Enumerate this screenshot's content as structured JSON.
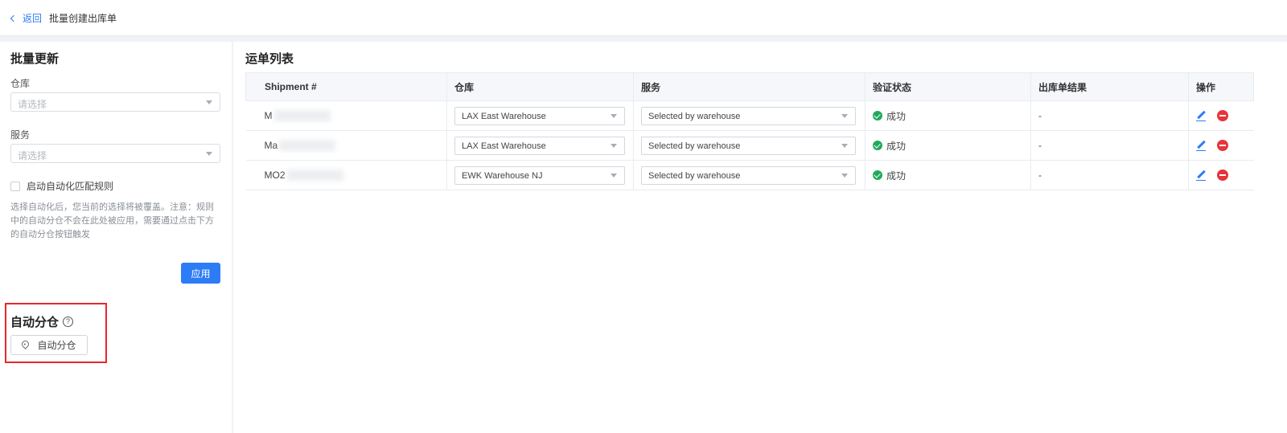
{
  "header": {
    "back_label": "返回",
    "title": "批量创建出库单"
  },
  "bulk_update": {
    "title": "批量更新",
    "warehouse_label": "仓库",
    "warehouse_placeholder": "请选择",
    "service_label": "服务",
    "service_placeholder": "请选择",
    "auto_match_label": "启动自动化匹配规则",
    "hint": "选择自动化后，您当前的选择将被覆盖。注意：规则中的自动分仓不会在此处被应用，需要通过点击下方的自动分仓按钮触发",
    "apply_label": "应用"
  },
  "auto_allocate": {
    "title": "自动分仓",
    "help_icon": "question-circle-icon",
    "button_label": "自动分仓",
    "button_icon": "location-pin-icon"
  },
  "shipments": {
    "title": "运单列表",
    "columns": [
      "Shipment #",
      "仓库",
      "服务",
      "验证状态",
      "出库单结果",
      "操作"
    ],
    "rows": [
      {
        "shipment": "M",
        "warehouse": "LAX East Warehouse",
        "service": "Selected by warehouse",
        "status": "成功",
        "result": "-"
      },
      {
        "shipment": "Ma",
        "warehouse": "LAX East Warehouse",
        "service": "Selected by warehouse",
        "status": "成功",
        "result": "-"
      },
      {
        "shipment": "MO2",
        "warehouse": "EWK Warehouse NJ",
        "service": "Selected by warehouse",
        "status": "成功",
        "result": "-"
      }
    ]
  },
  "colors": {
    "primary": "#2d7cf6",
    "success": "#21a95a",
    "danger": "#e8333a",
    "highlight": "#e8272c"
  }
}
